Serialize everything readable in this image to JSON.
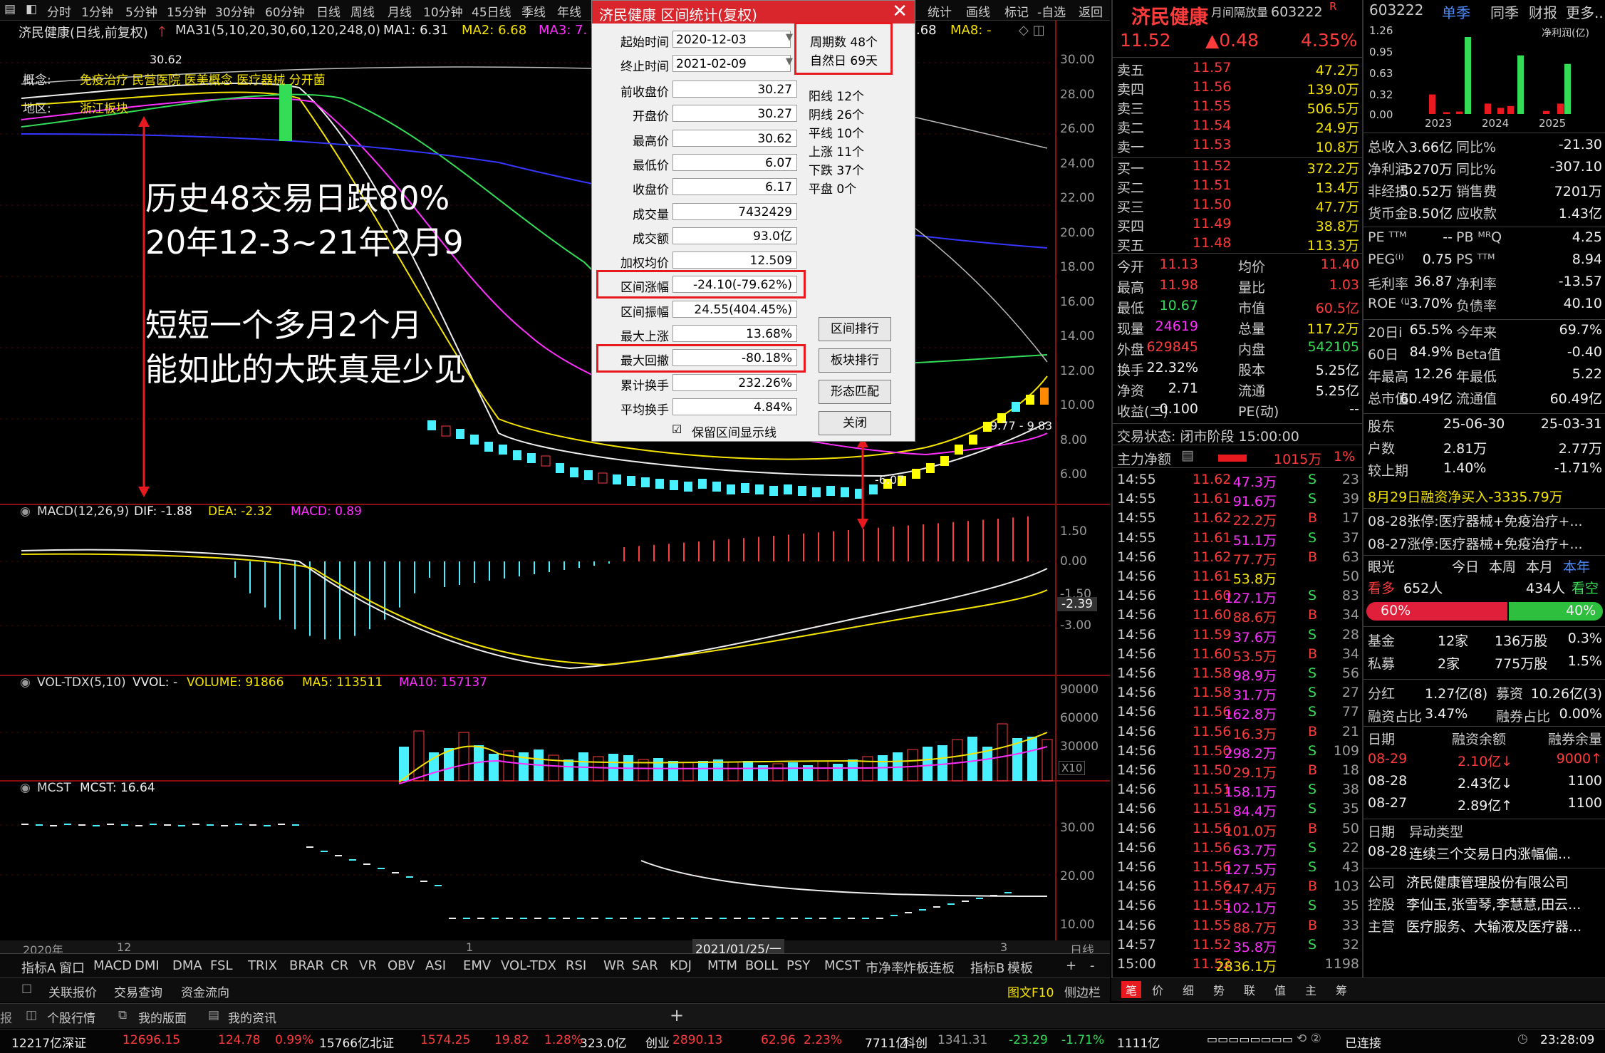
{
  "topbar": {
    "periods": [
      "分时",
      "1分钟",
      "5分钟",
      "15分钟",
      "30分钟",
      "60分钟",
      "日线",
      "周线",
      "月线",
      "10分钟",
      "45日线",
      "季线",
      "年线"
    ],
    "active_period": "日线",
    "right_items": [
      "统计",
      "画线",
      "标记",
      "-自选",
      "返回"
    ]
  },
  "chart_header": {
    "stock": "济民健康(日线,前复权)",
    "ma_label": "MA31(5,10,20,30,60,120,248,0)",
    "ma1": "MA1: 6.31",
    "ma2": "MA2: 6.68",
    "ma3": "MA3: 7.",
    "ma8": "MA8: -",
    "ma_right": ".68"
  },
  "concept_tags": {
    "label": "概念:",
    "tags": "免疫治疗 民营医院 医美概念 医疗器械 分开菌",
    "region_label": "地区:",
    "region": "浙江板块"
  },
  "price_axis": [
    "30.00",
    "28.00",
    "26.00",
    "24.00",
    "22.00",
    "20.00",
    "18.00",
    "16.00",
    "14.00",
    "12.00",
    "10.00",
    "8.00",
    "6.00"
  ],
  "price_markers": {
    "high": "30.62",
    "low_label": "-6.07",
    "right_label": "9.77 - 9.83"
  },
  "annotation": {
    "line1": "历史48交易日跌80%",
    "line2": "20年12-3~21年2月9",
    "line3": "短短一个多月2个月",
    "line4": "能如此的大跌真是少见"
  },
  "macd": {
    "label": "MACD(12,26,9)",
    "dif": "DIF: -1.88",
    "dea": "DEA: -2.32",
    "macd": "MACD: 0.89",
    "axis": [
      "1.50",
      "0.00",
      "-1.50",
      "-3.00"
    ],
    "current": "-2.39"
  },
  "vol": {
    "label": "VOL-TDX(5,10)",
    "vvol": "VVOL: -",
    "volume": "VOLUME: 91866",
    "ma5": "MA5: 113511",
    "ma10": "MA10: 157137",
    "axis": [
      "90000",
      "60000",
      "30000"
    ],
    "unit": "X10"
  },
  "mcst": {
    "label": "MCST",
    "value": "MCST: 16.64",
    "axis": [
      "30.00",
      "20.00",
      "10.00"
    ]
  },
  "date_axis": {
    "left": "2020年",
    "mid1": "12",
    "mid2": "1",
    "cursor": "2021/01/25/一",
    "right": "3",
    "period": "日线"
  },
  "indicator_tabs": [
    "指标A",
    "窗口",
    "MACD",
    "DMI",
    "DMA",
    "FSL",
    "TRIX",
    "BRAR",
    "CR",
    "VR",
    "OBV",
    "ASI",
    "EMV",
    "VOL-TDX",
    "RSI",
    "WR",
    "SAR",
    "KDJ",
    "MTM",
    "BOLL",
    "PSY",
    "MCST",
    "市净率",
    "炸板连板"
  ],
  "indicator_right": [
    "指标B",
    "模板",
    "+",
    "-"
  ],
  "active_indicator": "MCST",
  "bottom_links": [
    "关联报价",
    "交易查询",
    "资金流向"
  ],
  "bottom_right": [
    "图文F10",
    "侧边栏"
  ],
  "bottom2": [
    "个股行情",
    "我的版面",
    "我的资讯"
  ],
  "dialog": {
    "title": "济民健康 区间统计(复权)",
    "start_label": "起始时间",
    "start": "2020-12-03",
    "end_label": "终止时间",
    "end": "2021-02-09",
    "period_count": "周期数 48个",
    "natural_days": "自然日 69天",
    "fields": [
      {
        "label": "前收盘价",
        "value": "30.27"
      },
      {
        "label": "开盘价",
        "value": "30.27"
      },
      {
        "label": "最高价",
        "value": "30.62"
      },
      {
        "label": "最低价",
        "value": "6.07"
      },
      {
        "label": "收盘价",
        "value": "6.17"
      },
      {
        "label": "成交量",
        "value": "7432429"
      },
      {
        "label": "成交额",
        "value": "93.0亿"
      },
      {
        "label": "加权均价",
        "value": "12.509"
      },
      {
        "label": "区间涨幅",
        "value": "-24.10(-79.62%)"
      },
      {
        "label": "区间振幅",
        "value": "24.55(404.45%)"
      },
      {
        "label": "最大上涨",
        "value": "13.68%"
      },
      {
        "label": "最大回撤",
        "value": "-80.18%"
      },
      {
        "label": "累计换手",
        "value": "232.26%"
      },
      {
        "label": "平均换手",
        "value": "4.84%"
      }
    ],
    "stats": [
      "阳线 12个",
      "阴线 26个",
      "平线 10个",
      "上涨 11个",
      "下跌 37个",
      "平盘 0个"
    ],
    "buttons": [
      "区间排行",
      "板块排行",
      "形态匹配",
      "关闭"
    ],
    "checkbox": "保留区间显示线"
  },
  "quote": {
    "name": "济民健康",
    "sub": "月间隔放量",
    "code": "603222",
    "flag": "R",
    "price": "11.52",
    "change": "▲0.48",
    "pct": "4.35%",
    "asks": [
      {
        "label": "卖五",
        "price": "11.57",
        "vol": "47.2万"
      },
      {
        "label": "卖四",
        "price": "11.56",
        "vol": "139.0万"
      },
      {
        "label": "卖三",
        "price": "11.55",
        "vol": "506.5万"
      },
      {
        "label": "卖二",
        "price": "11.54",
        "vol": "24.9万"
      },
      {
        "label": "卖一",
        "price": "11.53",
        "vol": "10.8万"
      }
    ],
    "bids": [
      {
        "label": "买一",
        "price": "11.52",
        "vol": "372.2万"
      },
      {
        "label": "买二",
        "price": "11.51",
        "vol": "13.4万"
      },
      {
        "label": "买三",
        "price": "11.50",
        "vol": "47.7万"
      },
      {
        "label": "买四",
        "price": "11.49",
        "vol": "38.8万"
      },
      {
        "label": "买五",
        "price": "11.48",
        "vol": "113.3万"
      }
    ],
    "stats": [
      [
        "今开",
        "11.13",
        "均价",
        "11.40"
      ],
      [
        "最高",
        "11.98",
        "量比",
        "1.03"
      ],
      [
        "最低",
        "10.67",
        "市值",
        "60.5亿"
      ],
      [
        "现量",
        "24619",
        "总量",
        "117.2万"
      ],
      [
        "外盘",
        "629845",
        "内盘",
        "542105"
      ],
      [
        "换手",
        "22.32%",
        "股本",
        "5.25亿"
      ],
      [
        "净资",
        "2.71",
        "流通",
        "5.25亿"
      ],
      [
        "收益(二)",
        "-0.100",
        "PE(动)",
        "--"
      ]
    ],
    "status": "交易状态: 闭市阶段 15:00:00",
    "net_flow_label": "主力净额",
    "net_flow": "1015万",
    "net_flow_pct": "1%",
    "ticks": [
      [
        "14:55",
        "11.62",
        "47.3万",
        "S",
        "23"
      ],
      [
        "14:55",
        "11.61",
        "91.6万",
        "S",
        "39"
      ],
      [
        "14:55",
        "11.62",
        "22.2万",
        "B",
        "17"
      ],
      [
        "14:55",
        "11.61",
        "51.1万",
        "S",
        "37"
      ],
      [
        "14:56",
        "11.62",
        "77.7万",
        "B",
        "63"
      ],
      [
        "14:56",
        "11.61",
        "53.8万",
        "",
        "50"
      ],
      [
        "14:56",
        "11.60",
        "127.1万",
        "S",
        "83"
      ],
      [
        "14:56",
        "11.60",
        "88.6万",
        "B",
        "34"
      ],
      [
        "14:56",
        "11.59",
        "37.6万",
        "S",
        "28"
      ],
      [
        "14:56",
        "11.60",
        "53.5万",
        "B",
        "34"
      ],
      [
        "14:56",
        "11.58",
        "98.9万",
        "S",
        "56"
      ],
      [
        "14:56",
        "11.58",
        "31.7万",
        "S",
        "27"
      ],
      [
        "14:56",
        "11.56",
        "162.8万",
        "S",
        "77"
      ],
      [
        "14:56",
        "11.56",
        "16.3万",
        "B",
        "21"
      ],
      [
        "14:56",
        "11.50",
        "298.2万",
        "S",
        "109"
      ],
      [
        "14:56",
        "11.50",
        "29.1万",
        "B",
        "18"
      ],
      [
        "14:56",
        "11.51",
        "158.1万",
        "S",
        "38"
      ],
      [
        "14:56",
        "11.51",
        "84.4万",
        "S",
        "35"
      ],
      [
        "14:56",
        "11.56",
        "101.0万",
        "B",
        "50"
      ],
      [
        "14:56",
        "11.56",
        "63.7万",
        "S",
        "22"
      ],
      [
        "14:56",
        "11.56",
        "127.5万",
        "S",
        "43"
      ],
      [
        "14:56",
        "11.56",
        "247.4万",
        "B",
        "103"
      ],
      [
        "14:56",
        "11.55",
        "102.1万",
        "S",
        "35"
      ],
      [
        "14:56",
        "11.55",
        "88.7万",
        "B",
        "33"
      ],
      [
        "14:57",
        "11.52",
        "35.8万",
        "S",
        "32"
      ],
      [
        "15:00",
        "11.52",
        "2836.1万",
        "",
        "1198"
      ]
    ],
    "bottom_tabs": [
      "笔",
      "价",
      "细",
      "势",
      "联",
      "值",
      "主",
      "筹"
    ]
  },
  "f10": {
    "code": "603222",
    "tabs": [
      "单季",
      "同季",
      "财报",
      "更多.."
    ],
    "bar_axis": [
      "1.26",
      "0.95",
      "0.63",
      "0.32",
      "0.00"
    ],
    "bar_legend": "净利润(亿)",
    "bar_years": [
      "2023",
      "2024",
      "2025"
    ],
    "bar_data": {
      "type": "bar",
      "series": [
        {
          "values": [
            0.32,
            0.03,
            0.04,
            1.26,
            0.17,
            0.1,
            0.13,
            0.96,
            0.05,
            0.17,
            0.82
          ]
        }
      ]
    },
    "fin": [
      [
        "总收入",
        "3.66亿",
        "同比%",
        "-21.30"
      ],
      [
        "净利润",
        "-5270万",
        "同比%",
        "-307.10"
      ],
      [
        "非经损",
        "50.52万",
        "销售费",
        "7201万"
      ],
      [
        "货币金i",
        "3.50亿",
        "应收款",
        "1.43亿"
      ]
    ],
    "val": [
      [
        "PE ᵀᵀᴹ",
        "--",
        "PB ᴹᴿQ",
        "4.25"
      ],
      [
        "PEG⁽ⁱ⁾",
        "0.75",
        "PS ᵀᵀᴹ",
        "8.94"
      ],
      [
        "毛利率",
        "36.87",
        "净利率",
        "-13.57"
      ],
      [
        "ROE ⁽ⁱ⁾",
        "-3.70%",
        "负债率",
        "40.10"
      ]
    ],
    "perf": [
      [
        "20日i",
        "65.5%",
        "今年来",
        "69.7%"
      ],
      [
        "60日",
        "84.9%",
        "Beta值",
        "-0.40"
      ],
      [
        "年最高",
        "12.26",
        "年最低",
        "5.22"
      ],
      [
        "总市值i",
        "60.49亿",
        "流通值",
        "60.49亿"
      ]
    ],
    "holders": [
      [
        "股东",
        "25-06-30",
        "25-03-31"
      ],
      [
        "户数",
        "2.81万",
        "2.77万"
      ],
      [
        "较上期",
        "1.40%",
        "-1.71%"
      ]
    ],
    "margin_note": "8月29日融资净买入-3335.79万",
    "news": [
      "08-28张停:医疗器械+免疫治疗+...",
      "08-27涨停:医疗器械+免疫治疗+..."
    ],
    "vote_label": "眼光",
    "vote_tabs": [
      "今日",
      "本周",
      "本月",
      "本年"
    ],
    "bull_label": "看多",
    "bull": "652人",
    "bear": "434人",
    "bear_label": "看空",
    "bull_pct": "60%",
    "bear_pct": "40%",
    "funds": [
      [
        "基金",
        "12家",
        "136万股",
        "0.3%"
      ],
      [
        "私募",
        "2家",
        "775万股",
        "1.5%"
      ]
    ],
    "div": [
      "分红",
      "1.27亿(8)",
      "募资",
      "10.26亿(3)"
    ],
    "margin_ratio": [
      "融资占比",
      "3.47%",
      "融券占比",
      "0.00%"
    ],
    "margin_table_head": [
      "日期",
      "融资余额",
      "融券余量"
    ],
    "margin_rows": [
      [
        "08-29",
        "2.10亿↓",
        "9000↑"
      ],
      [
        "08-28",
        "2.43亿↓",
        "1100"
      ],
      [
        "08-27",
        "2.89亿↑",
        "1100"
      ]
    ],
    "events_head": [
      "日期",
      "异动类型"
    ],
    "events": [
      [
        "08-28",
        "连续三个交易日内涨幅偏..."
      ]
    ],
    "company": [
      "公司",
      "济民健康管理股份有限公司"
    ],
    "holder": [
      "控股",
      "李仙玉,张雪琴,李慧慧,田云..."
    ],
    "business": [
      "主营",
      "医疗服务、大输液及医疗器..."
    ]
  },
  "statusbar": {
    "items": [
      "12217亿深证",
      "12696.15",
      "124.78",
      "0.99%",
      "15766亿北证",
      "1574.25",
      "19.82",
      "1.28%",
      "323.0亿",
      "创业",
      "2890.13",
      "62.96",
      "2.23%",
      "7711亿",
      "科创",
      "1341.31",
      "-23.29",
      "-1.71%",
      "1111亿"
    ],
    "connection": "已连接",
    "time": "23:28:09"
  }
}
